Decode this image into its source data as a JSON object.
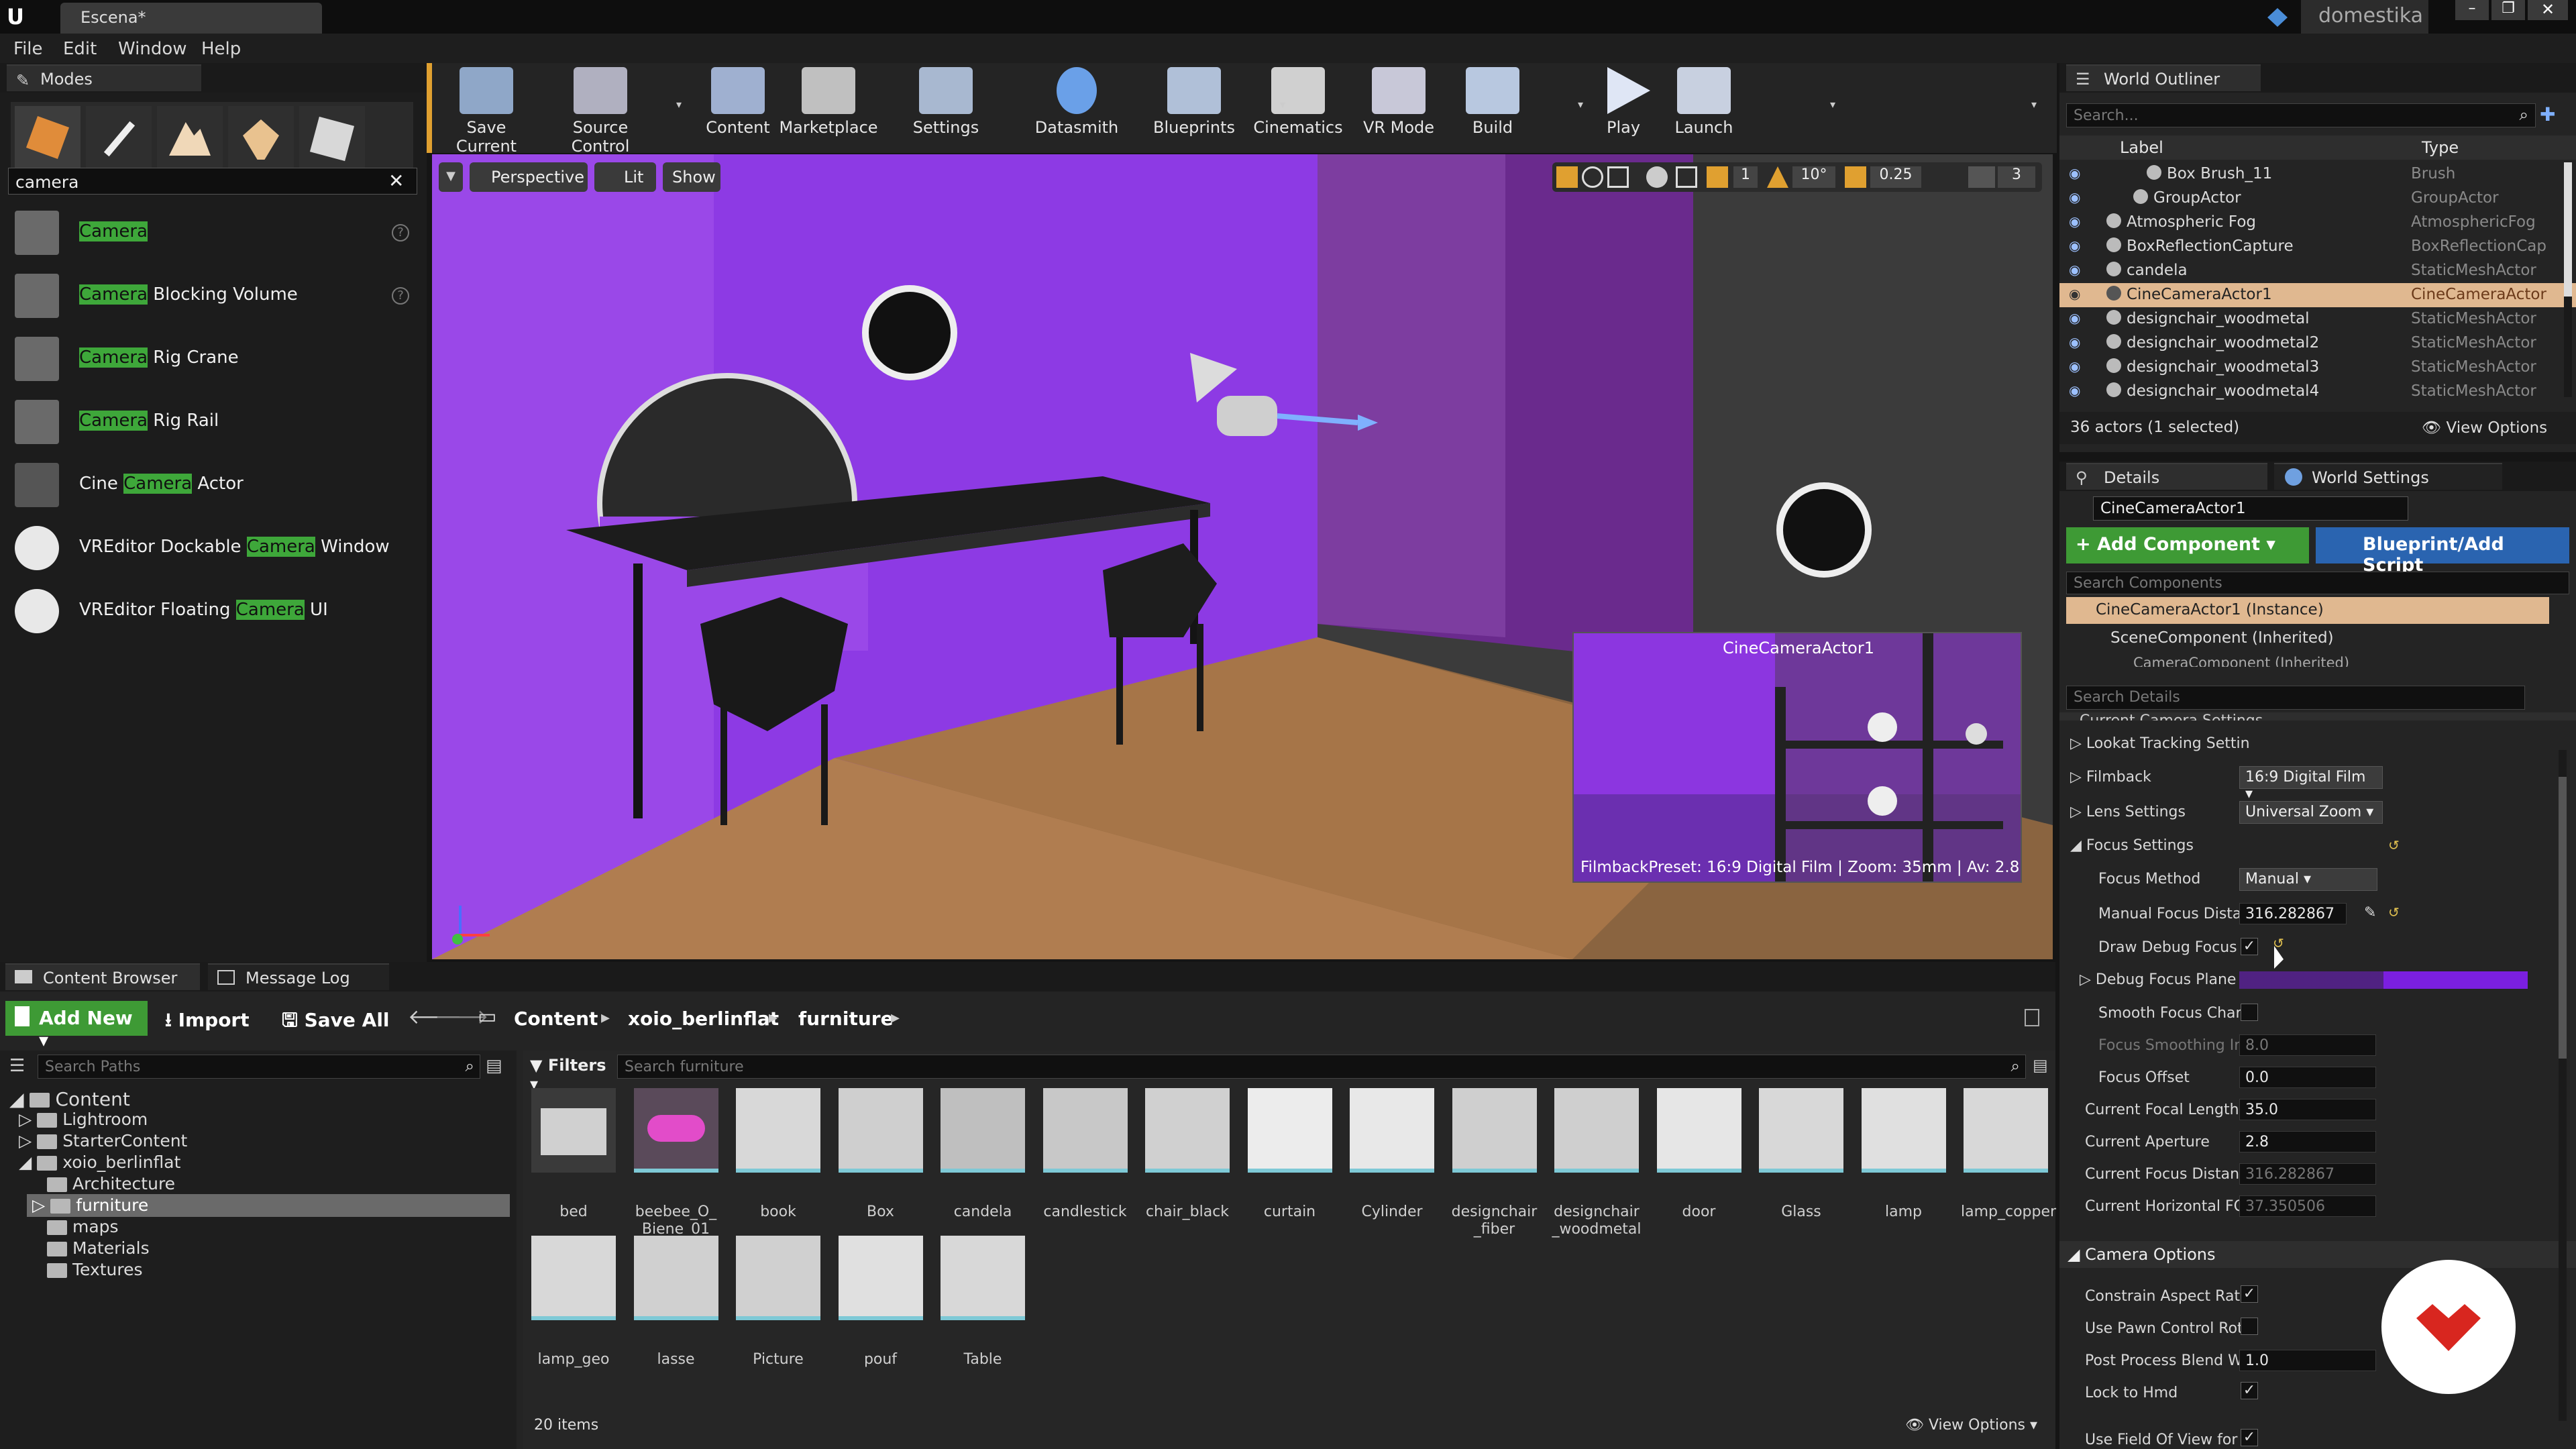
{
  "window": {
    "tab_title": "Escena*",
    "brand": "domestika"
  },
  "menu": [
    "File",
    "Edit",
    "Window",
    "Help"
  ],
  "modes": {
    "tab_label": "Modes",
    "search_value": "camera",
    "results": [
      {
        "highlight": "Camera",
        "rest": ""
      },
      {
        "highlight": "Camera",
        "rest": " Blocking Volume"
      },
      {
        "highlight": "Camera",
        "rest": " Rig Crane"
      },
      {
        "highlight": "Camera",
        "rest": " Rig Rail"
      },
      {
        "prefix": "Cine ",
        "highlight": "Camera",
        "rest": " Actor"
      },
      {
        "prefix": "VREditor Dockable ",
        "highlight": "Camera",
        "rest": " Window"
      },
      {
        "prefix": "VREditor Floating ",
        "highlight": "Camera",
        "rest": " UI"
      }
    ]
  },
  "toolbar": [
    "Save Current",
    "Source Control",
    "Content",
    "Marketplace",
    "Settings",
    "Datasmith",
    "Blueprints",
    "Cinematics",
    "VR Mode",
    "Build",
    "Play",
    "Launch"
  ],
  "viewport": {
    "perspective": "Perspective",
    "lit": "Lit",
    "show": "Show",
    "snap_angle": "10°",
    "snap_scale": "0.25",
    "camera_speed": "3",
    "layer_count": "1",
    "pip_title": "CineCameraActor1",
    "pip_caption": "FilmbackPreset: 16:9 Digital Film | Zoom: 35mm | Av: 2.8"
  },
  "outliner": {
    "tab_label": "World Outliner",
    "search_placeholder": "Search...",
    "col_label": "Label",
    "col_type": "Type",
    "rows": [
      {
        "label": "Box Brush_11",
        "type": "Brush"
      },
      {
        "label": "GroupActor",
        "type": "GroupActor"
      },
      {
        "label": "Atmospheric Fog",
        "type": "AtmosphericFog"
      },
      {
        "label": "BoxReflectionCapture",
        "type": "BoxReflectionCap"
      },
      {
        "label": "candela",
        "type": "StaticMeshActor"
      },
      {
        "label": "CineCameraActor1",
        "type": "CineCameraActor"
      },
      {
        "label": "designchair_woodmetal",
        "type": "StaticMeshActor"
      },
      {
        "label": "designchair_woodmetal2",
        "type": "StaticMeshActor"
      },
      {
        "label": "designchair_woodmetal3",
        "type": "StaticMeshActor"
      },
      {
        "label": "designchair_woodmetal4",
        "type": "StaticMeshActor"
      }
    ],
    "status": "36 actors (1 selected)",
    "view_options": "View Options"
  },
  "details": {
    "tab_label": "Details",
    "world_settings_tab": "World Settings",
    "actor_name": "CineCameraActor1",
    "add_component": "+ Add Component",
    "blueprint": "Blueprint/Add Script",
    "search_components": "Search Components",
    "instance": "CineCameraActor1 (Instance)",
    "scene_component": "SceneComponent (Inherited)",
    "camera_component": "CameraComponent (Inherited)",
    "search_details": "Search Details",
    "section_current": "Current Camera Settings",
    "lookat": "Lookat Tracking Settin",
    "filmback": "Filmback",
    "filmback_value": "16:9 Digital Film",
    "lens": "Lens Settings",
    "lens_value": "Universal Zoom",
    "focus_settings": "Focus Settings",
    "focus_method": "Focus Method",
    "focus_method_value": "Manual",
    "manual_focus": "Manual Focus Distar",
    "manual_focus_value": "316.282867",
    "draw_debug": "Draw Debug Focus P",
    "debug_plane": "Debug Focus Plane",
    "smooth_focus": "Smooth Focus Chan",
    "focus_smoothing": "Focus Smoothing Int",
    "focus_smoothing_value": "8.0",
    "focus_offset": "Focus Offset",
    "focus_offset_value": "0.0",
    "focal_length": "Current Focal Length",
    "focal_length_value": "35.0",
    "aperture": "Current Aperture",
    "aperture_value": "2.8",
    "focus_distance": "Current Focus Distanc",
    "focus_distance_value": "316.282867",
    "horizontal_fov": "Current Horizontal FO",
    "horizontal_fov_value": "37.350506",
    "camera_options": "Camera Options",
    "constrain": "Constrain Aspect Ratio",
    "pawn_control": "Use Pawn Control Rota",
    "post_process": "Post Process Blend W",
    "post_process_value": "1.0",
    "lock_hmd": "Lock to Hmd",
    "use_fov": "Use Field Of View for L",
    "debug_plane_color": "#7b1fe0"
  },
  "content_browser": {
    "tab_label": "Content Browser",
    "message_log": "Message Log",
    "add_new": "Add New",
    "import": "Import",
    "save_all": "Save All",
    "breadcrumb": [
      "Content",
      "xoio_berlinflat",
      "furniture"
    ],
    "search_paths": "Search Paths",
    "filters": "Filters",
    "search_assets": "Search furniture",
    "tree": [
      "Content",
      "Lightroom",
      "StarterContent",
      "xoio_berlinflat",
      "Architecture",
      "furniture",
      "maps",
      "Materials",
      "Textures"
    ],
    "assets": [
      "bed",
      "beebee_O_Biene_01",
      "book",
      "Box",
      "candela",
      "candlestick",
      "chair_black",
      "curtain",
      "Cylinder",
      "designchair_fiber",
      "designchair_woodmetal",
      "door",
      "Glass",
      "lamp",
      "lamp_copper",
      "lamp_geo",
      "lasse",
      "Picture",
      "pouf",
      "Table"
    ],
    "count": "20 items",
    "view_options": "View Options"
  }
}
